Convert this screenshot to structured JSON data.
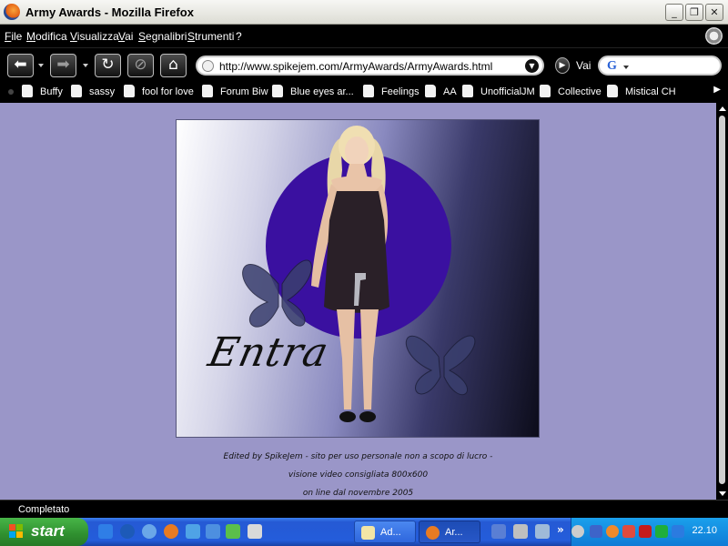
{
  "window": {
    "title": "Army Awards - Mozilla Firefox",
    "controls": {
      "minimize": "_",
      "restore": "❐",
      "close": "✕"
    }
  },
  "menu": {
    "items": [
      "File",
      "Modifica",
      "Visualizza",
      "Vai",
      "Segnalibri",
      "Strumenti",
      "?"
    ]
  },
  "nav": {
    "back_icon": "back-arrow-icon",
    "forward_icon": "forward-arrow-icon",
    "reload_icon": "reload-icon",
    "stop_icon": "stop-icon",
    "home_icon": "home-icon",
    "url": "http://www.spikejem.com/ArmyAwards/ArmyAwards.html",
    "go_label": "Vai",
    "search_engine": "G"
  },
  "bookmarks": [
    "Buffy",
    "sassy",
    "fool for love",
    "Forum Biw",
    "Blue eyes ar...",
    "Feelings",
    "AA",
    "UnofficialJM",
    "Collective",
    "Mistical CH"
  ],
  "content": {
    "background": "#9a96c8",
    "banner_text": "Entra",
    "footer": [
      "Edited by SpikeJem - sito per uso personale non a scopo di lucro -",
      "visione video consigliata 800x600",
      "on line dal novembre 2005"
    ]
  },
  "status": {
    "text": "Completato"
  },
  "taskbar": {
    "start_label": "start",
    "tasks": [
      {
        "label": "Ad...",
        "active": false
      },
      {
        "label": "Ar...",
        "active": true
      }
    ],
    "clock": "22.10"
  }
}
